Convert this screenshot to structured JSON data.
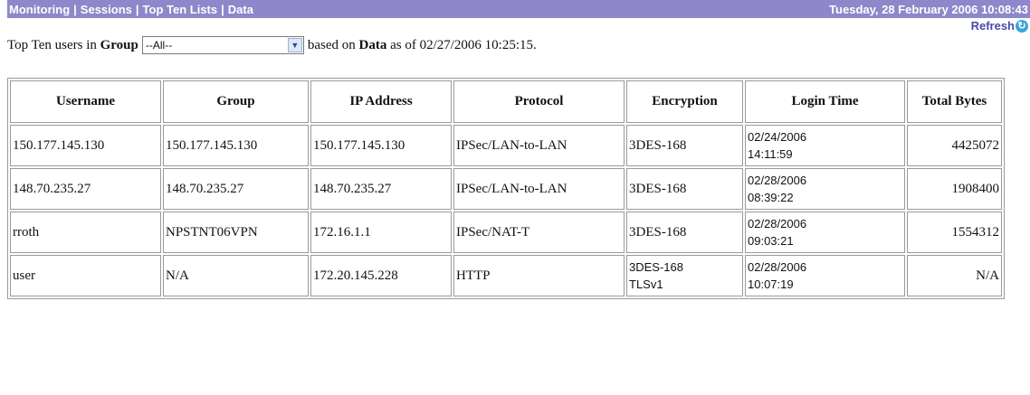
{
  "header": {
    "nav": [
      "Monitoring",
      "Sessions",
      "Top Ten Lists",
      "Data"
    ],
    "separator": "|",
    "datetime": "Tuesday, 28 February 2006 10:08:43",
    "refresh_label": "Refresh"
  },
  "filter": {
    "prefix": "Top Ten users in",
    "group_word": "Group",
    "group_value": "--All--",
    "middle": "based on",
    "data_word": "Data",
    "suffix": "as of 02/27/2006 10:25:15."
  },
  "table": {
    "columns": [
      "Username",
      "Group",
      "IP Address",
      "Protocol",
      "Encryption",
      "Login Time",
      "Total Bytes"
    ],
    "rows": [
      [
        "150.177.145.130",
        "150.177.145.130",
        "150.177.145.130",
        "IPSec/LAN-to-LAN",
        "3DES-168",
        "02/24/2006\n14:11:59",
        "4425072"
      ],
      [
        "148.70.235.27",
        "148.70.235.27",
        "148.70.235.27",
        "IPSec/LAN-to-LAN",
        "3DES-168",
        "02/28/2006\n08:39:22",
        "1908400"
      ],
      [
        "rroth",
        "NPSTNT06VPN",
        "172.16.1.1",
        "IPSec/NAT-T",
        "3DES-168",
        "02/28/2006\n09:03:21",
        "1554312"
      ],
      [
        "user",
        "N/A",
        "172.20.145.228",
        "HTTP",
        "3DES-168\nTLSv1",
        "02/28/2006\n10:07:19",
        "N/A"
      ]
    ]
  }
}
